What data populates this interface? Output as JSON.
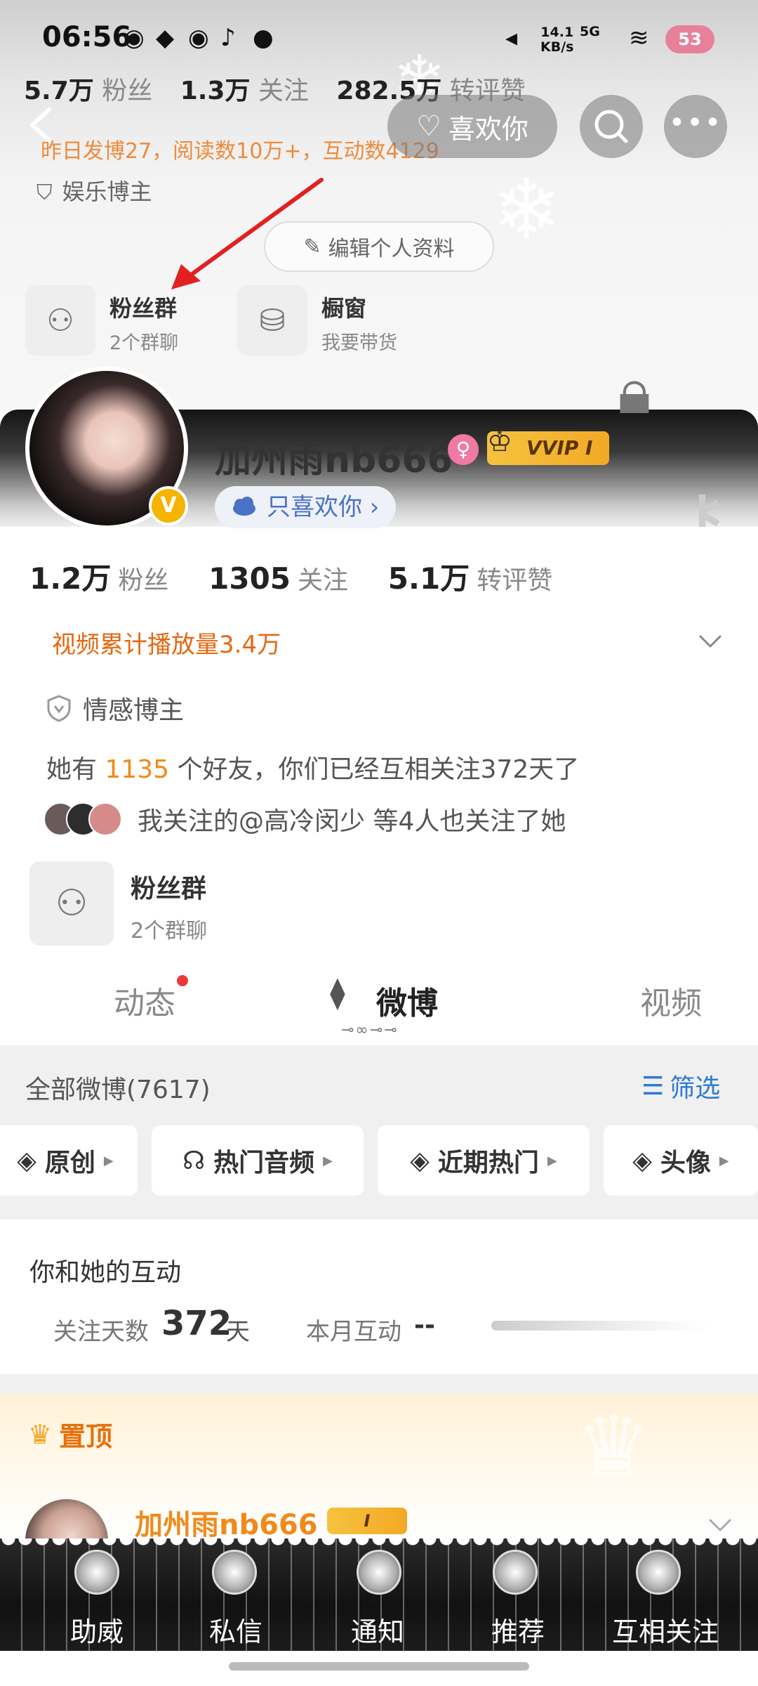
{
  "status_bar": {
    "time": "06:56",
    "net_speed_value": "14.1",
    "net_speed_unit": "KB/s",
    "network": "5G",
    "battery": "53"
  },
  "prev_profile": {
    "stats": [
      {
        "num": "5.7万",
        "label": "粉丝"
      },
      {
        "num": "1.3万",
        "label": "关注"
      },
      {
        "num": "282.5万",
        "label": "转评赞"
      }
    ],
    "highlight": "昨日发博27，阅读数10万+，互动数4129",
    "tag": "娱乐博主",
    "edit_profile_label": "编辑个人资料",
    "fan_group": {
      "title": "粉丝群",
      "sub": "2个群聊"
    },
    "shop": {
      "title": "橱窗",
      "sub": "我要带货"
    }
  },
  "header": {
    "like_button_label": "喜欢你"
  },
  "profile": {
    "username": "加州雨nb666",
    "vip_label": "VVIP I",
    "verified": "V",
    "like_only_label": "只喜欢你 ›",
    "stats": [
      {
        "num": "1.2万",
        "label": "粉丝"
      },
      {
        "num": "1305",
        "label": "关注"
      },
      {
        "num": "5.1万",
        "label": "转评赞"
      }
    ],
    "play_count": "视频累计播放量3.4万",
    "role_tag": "情感博主",
    "friends_prefix": "她有 ",
    "friends_count": "1135",
    "friends_suffix": " 个好友，你们已经互相关注372天了",
    "mutual_text": "我关注的@高冷闵少 等4人也关注了她",
    "fan_group_title": "粉丝群",
    "fan_group_sub": "2个群聊"
  },
  "tabs": [
    {
      "label": "动态"
    },
    {
      "label": "微博"
    },
    {
      "label": "视频"
    }
  ],
  "feed": {
    "all_label": "全部微博(7617)",
    "filter_label": "筛选",
    "chips": [
      "原创",
      "热门音频",
      "近期热门",
      "头像"
    ],
    "interaction_title": "你和她的互动",
    "follow_days_label": "关注天数",
    "follow_days_num": "372",
    "follow_days_unit": "天",
    "month_label": "本月互动",
    "month_value": "--",
    "pinned_label": "置顶",
    "post_author": "加州雨nb666",
    "post_vip": "I"
  },
  "bottom_nav": [
    {
      "label": "助威"
    },
    {
      "label": "私信"
    },
    {
      "label": "通知"
    },
    {
      "label": "推荐"
    },
    {
      "label": "互相关注"
    }
  ],
  "colors": {
    "accent_orange": "#e6670f",
    "link_blue": "#2d7ad6",
    "vip_gold": "#f6c33f",
    "annotation_red": "#e32020"
  }
}
